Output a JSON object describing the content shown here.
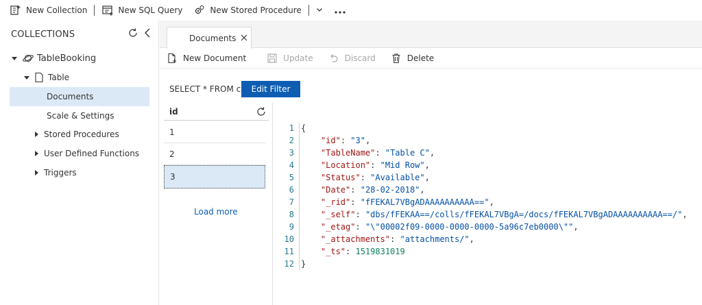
{
  "commandbar": {
    "new_collection": "New Collection",
    "new_sql_query": "New SQL Query",
    "new_stored_procedure": "New Stored Procedure"
  },
  "sidebar": {
    "title": "COLLECTIONS",
    "database": "TableBooking",
    "collection": "Table",
    "items": [
      {
        "label": "Documents"
      },
      {
        "label": "Scale & Settings"
      },
      {
        "label": "Stored Procedures"
      },
      {
        "label": "User Defined Functions"
      },
      {
        "label": "Triggers"
      }
    ]
  },
  "tab": {
    "label": "Documents"
  },
  "toolbar": {
    "new_document": "New Document",
    "update": "Update",
    "discard": "Discard",
    "delete": "Delete"
  },
  "filter": {
    "query": "SELECT * FROM c",
    "button": "Edit Filter"
  },
  "doclist": {
    "column": "id",
    "rows": [
      "1",
      "2",
      "3"
    ],
    "load_more": "Load more"
  },
  "editor": {
    "line_numbers": [
      "1",
      "2",
      "3",
      "4",
      "5",
      "6",
      "7",
      "8",
      "9",
      "10",
      "11",
      "12"
    ],
    "lines": [
      {
        "open": "{"
      },
      {
        "key": "\"id\"",
        "val": "\"3\"",
        "tail": ","
      },
      {
        "key": "\"TableName\"",
        "val": "\"Table C\"",
        "tail": ","
      },
      {
        "key": "\"Location\"",
        "val": "\"Mid Row\"",
        "tail": ","
      },
      {
        "key": "\"Status\"",
        "val": "\"Available\"",
        "tail": ","
      },
      {
        "key": "\"Date\"",
        "val": "\"28-02-2018\"",
        "tail": ","
      },
      {
        "key": "\"_rid\"",
        "val": "\"fFEKAL7VBgADAAAAAAAAAA==\"",
        "tail": ","
      },
      {
        "key": "\"_self\"",
        "val": "\"dbs/fFEKAA==/colls/fFEKAL7VBgA=/docs/fFEKAL7VBgADAAAAAAAAAA==/\"",
        "tail": ","
      },
      {
        "key": "\"_etag\"",
        "val": "\"\\\"00002f09-0000-0000-0000-5a96c7eb0000\\\"\"",
        "tail": ","
      },
      {
        "key": "\"_attachments\"",
        "val": "\"attachments/\"",
        "tail": ","
      },
      {
        "key": "\"_ts\"",
        "num": "1519831019",
        "tail": ""
      },
      {
        "open": "}"
      }
    ]
  },
  "colors": {
    "accent": "#0d5db3",
    "selected_bg": "#dbe9f7",
    "json_key": "#a31515",
    "json_string": "#0451a5",
    "json_number": "#098658"
  }
}
